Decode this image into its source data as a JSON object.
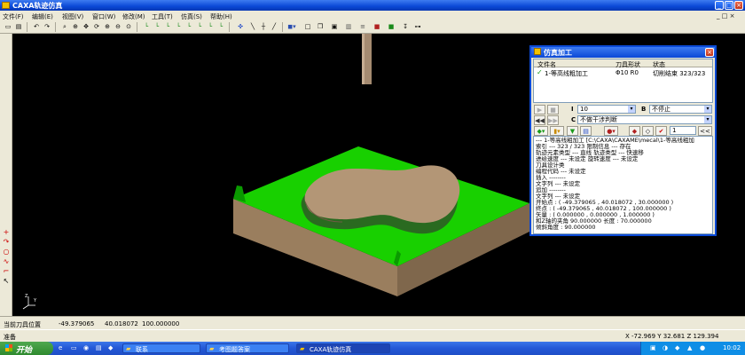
{
  "app": {
    "title": "CAXA轨迹仿真"
  },
  "menu": [
    "文件(F)",
    "编辑(E)",
    "视图(V)",
    "窗口(W)",
    "修改(M)",
    "工具(T)",
    "仿真(S)",
    "帮助(H)"
  ],
  "dialog": {
    "title": "仿真加工",
    "columns": {
      "file": "文件名",
      "tool": "刀具形状",
      "state": "状态"
    },
    "row": {
      "file": "1-等高线粗加工",
      "tool": "Φ10 R0",
      "state": "切削结束 323/323"
    },
    "field_i": {
      "label": "I",
      "value": "10"
    },
    "field_b": {
      "label": "B",
      "value": "不停止"
    },
    "field_c": {
      "label": "C",
      "value": "不做干涉判断"
    },
    "step_value": "1",
    "step_btn": "<<",
    "log": [
      "--- 1-等高线粗加工  [C:\\CAXA\\CAXAME\\mecal\\1-等高线粗加",
      "索引      ---  323 / 323    限制信息  --- 存在",
      "轨迹元素类型   ---   直线       轨迹类型   ---   快速移",
      "进给速度  ---   未设定      旋转速度  ---  未设定",
      "刀具设计类",
      "    编程代码   ---  未设定",
      "插入 --------",
      "      文字列   ---  未设定",
      "追加 --------",
      "      文字列   ---  未设定",
      "开始点       : ( -49.379065 , 40.018072 , 30.000000 )",
      "终点    : ( -49.379065 , 40.018072 , 100.000000 )",
      "矢量    : ( 0.000000 , 0.000000 , 1.000000 )",
      "和Z轴的夹角    90.000000  长度 : 70.000000",
      "倾斜角度 : 90.000000"
    ]
  },
  "status": {
    "label": "当前刀具位置",
    "x": "-49.379065",
    "y": "40.018072",
    "z": "100.000000",
    "ready": "准备",
    "coords": "X   -72.969  Y    32.681  Z   129.394"
  },
  "taskbar": {
    "start": "开始",
    "tasks": [
      "联系",
      "考图题答案",
      "CAXA轨迹仿真"
    ],
    "time": "10:02"
  }
}
